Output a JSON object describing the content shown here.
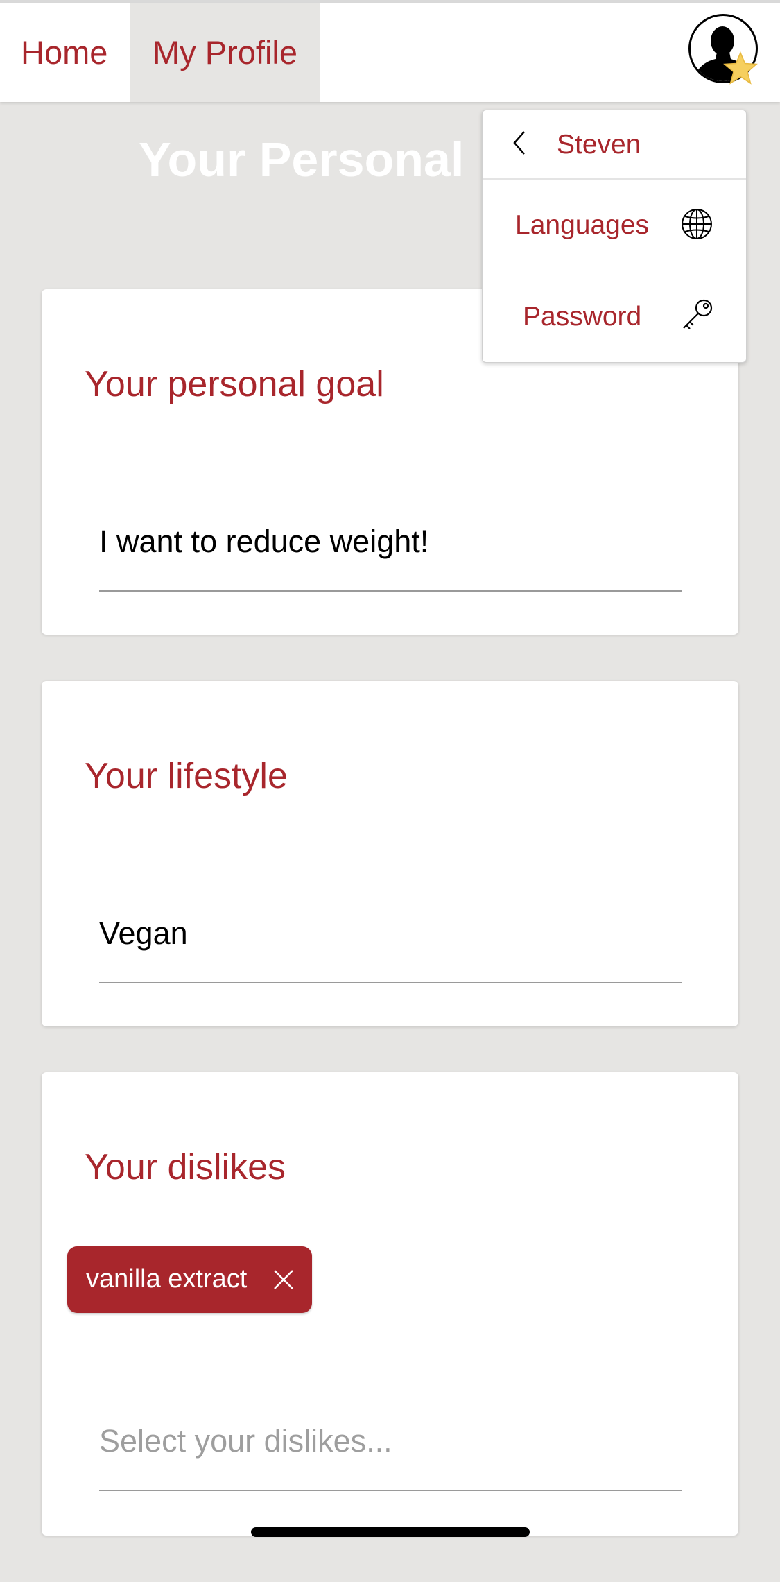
{
  "nav": {
    "home_label": "Home",
    "profile_label": "My Profile"
  },
  "page": {
    "title": "Your Personal"
  },
  "goal_card": {
    "title": "Your personal goal",
    "value": "I want to reduce weight!"
  },
  "lifestyle_card": {
    "title": "Your lifestyle",
    "value": "Vegan"
  },
  "dislikes_card": {
    "title": "Your dislikes",
    "chips": [
      "vanilla extract"
    ],
    "placeholder": "Select your dislikes..."
  },
  "user_menu": {
    "user_name": "Steven",
    "items": [
      {
        "label": "Languages",
        "icon": "globe-icon"
      },
      {
        "label": "Password",
        "icon": "key-icon"
      }
    ]
  },
  "icons": {
    "avatar": "person-silhouette-icon",
    "badge": "star-icon",
    "back": "chevron-left-icon",
    "chip_remove": "close-icon"
  },
  "colors": {
    "accent": "#a8262c",
    "background": "#e6e5e3",
    "star": "#f6cf5e"
  }
}
